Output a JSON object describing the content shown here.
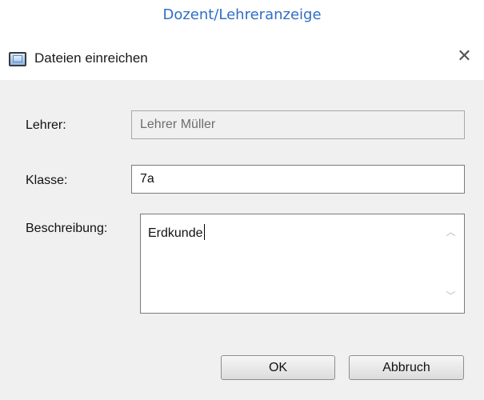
{
  "caption": "Dozent/Lehreranzeige",
  "window": {
    "title": "Dateien einreichen",
    "close_glyph": "✕",
    "app_icon": "window-icon"
  },
  "form": {
    "teacher": {
      "label": "Lehrer:",
      "value": "Lehrer Müller",
      "readonly": true
    },
    "class": {
      "label": "Klasse:",
      "value": "7a"
    },
    "description": {
      "label": "Beschreibung:",
      "value": "Erdkunde",
      "scroll_up_glyph": "︿",
      "scroll_down_glyph": "﹀"
    }
  },
  "buttons": {
    "ok_label": "OK",
    "cancel_label": "Abbruch"
  }
}
